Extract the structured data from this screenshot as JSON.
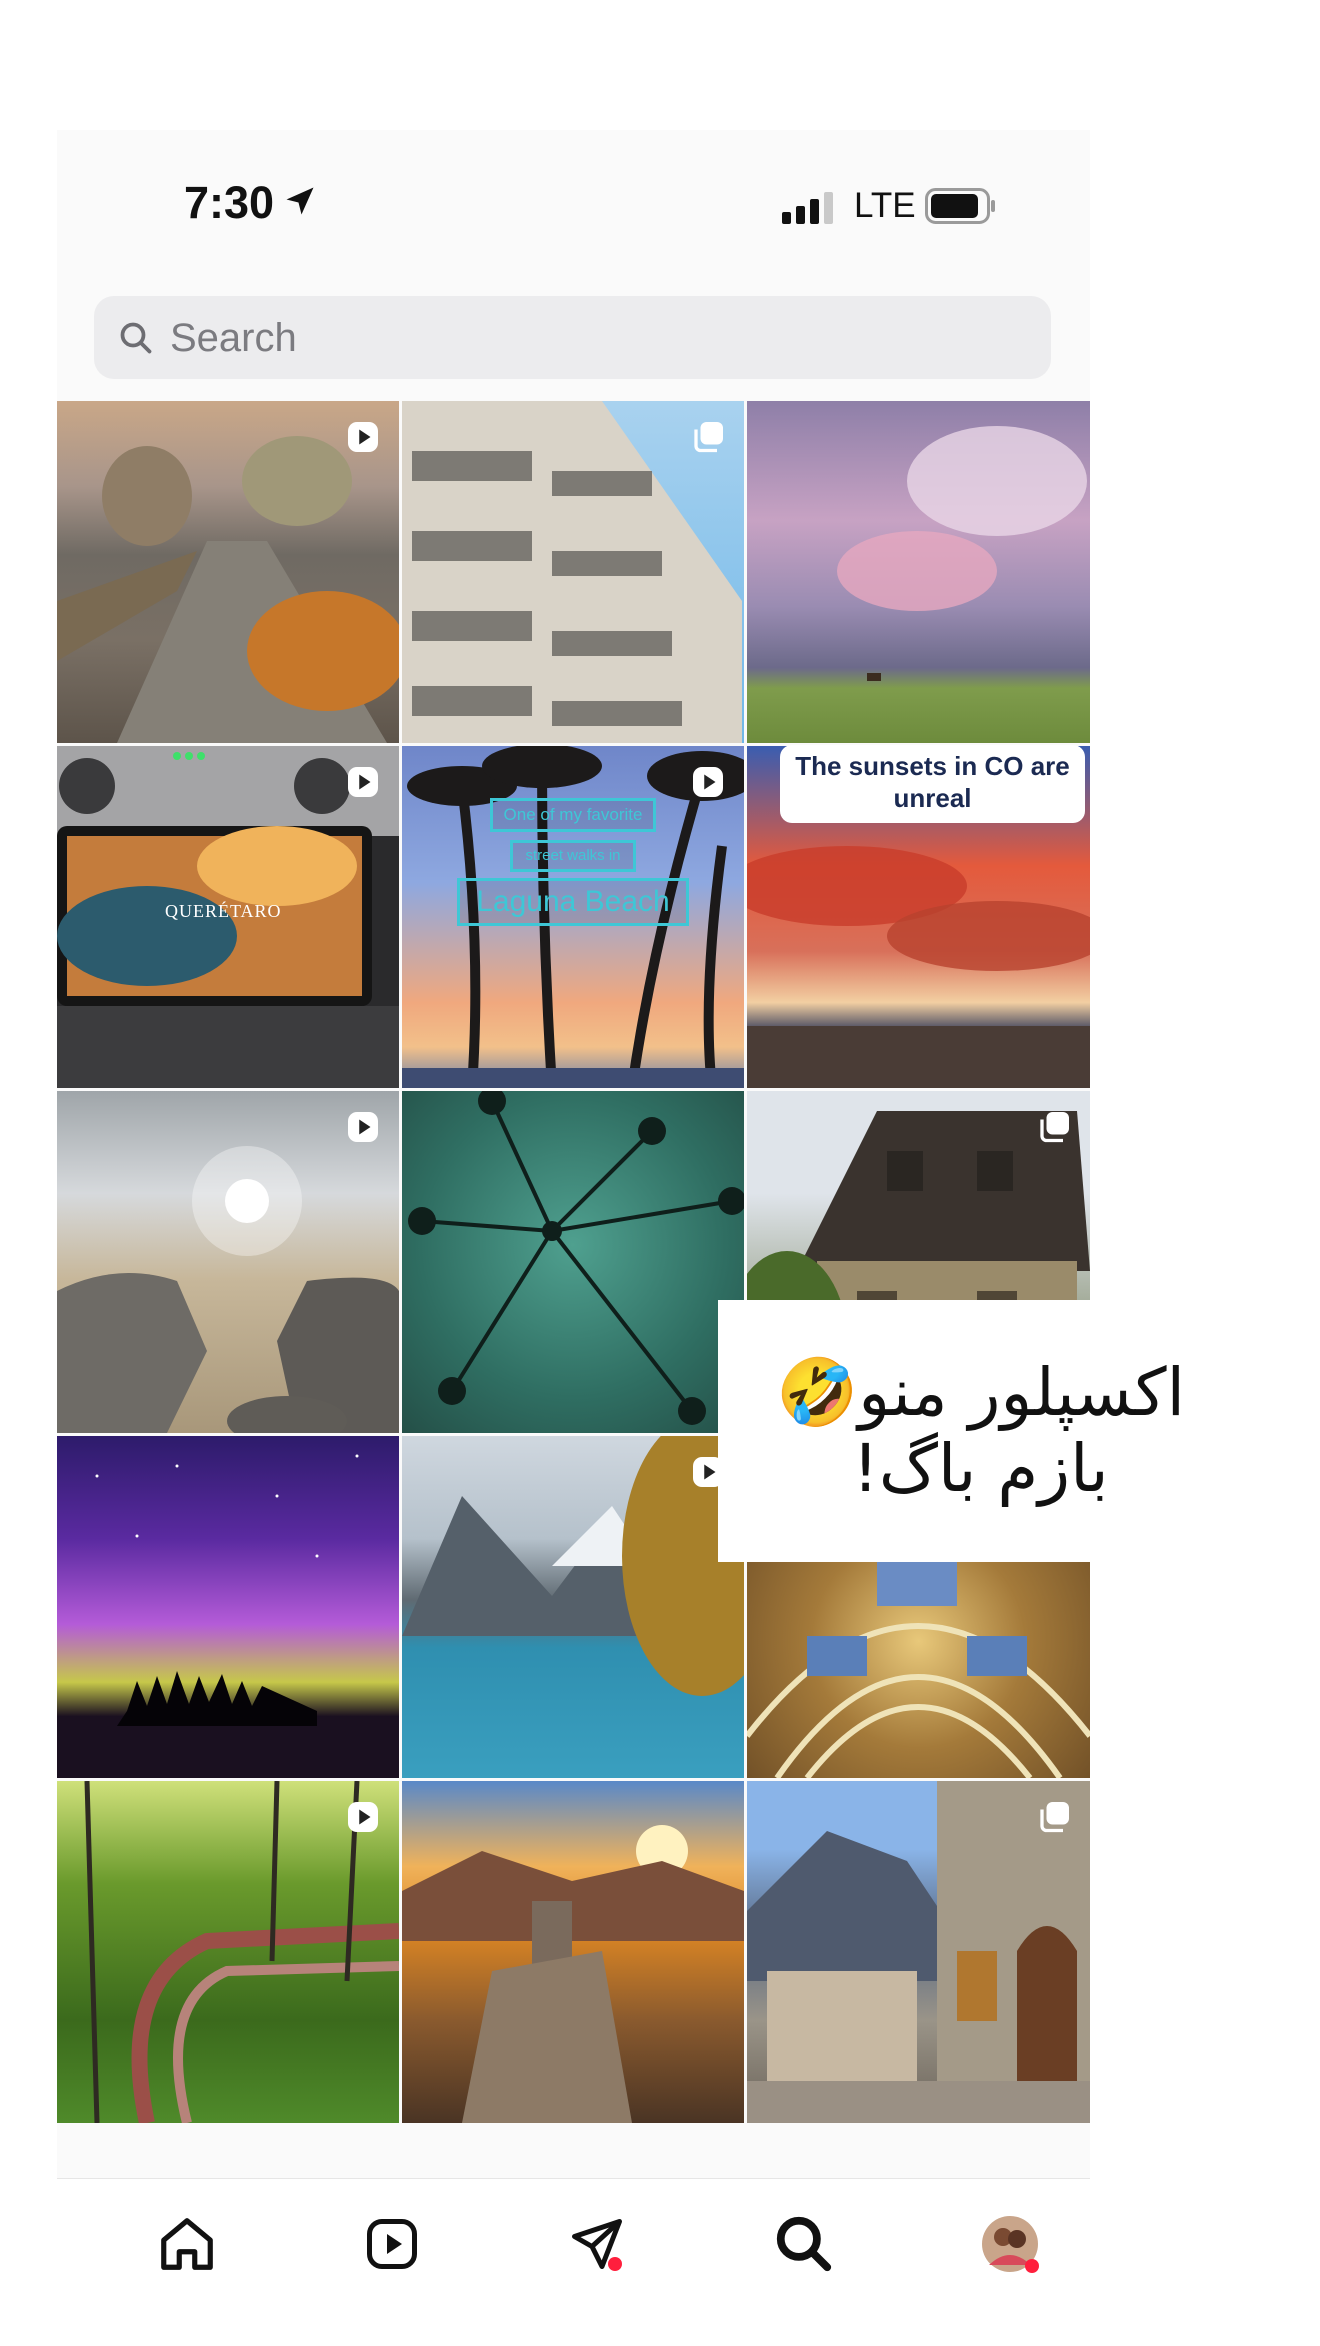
{
  "status_bar": {
    "time": "7:30",
    "network": "LTE"
  },
  "search": {
    "placeholder": "Search"
  },
  "grid": {
    "tiles": [
      {
        "subject": "autumn pier path at sunset",
        "badge": "reel-icon"
      },
      {
        "subject": "apartment balconies against blue sky",
        "badge": "carousel-icon"
      },
      {
        "subject": "pink storm clouds over prairie with bison",
        "badge": "none"
      },
      {
        "subject": "drone controller screen",
        "badge": "reel-icon",
        "text": "QUERÉTARO"
      },
      {
        "subject": "palm trees at sunset",
        "badge": "reel-icon",
        "texts": [
          "One of my favorite",
          "street walks in",
          "Laguna Beach"
        ]
      },
      {
        "subject": "red sunset clouds over town",
        "badge": "reel-icon",
        "text": "The sunsets in CO are unreal"
      },
      {
        "subject": "sunlight through clear water over rocks",
        "badge": "reel-icon"
      },
      {
        "subject": "rain drops on glass with palm trees",
        "badge": "none"
      },
      {
        "subject": "thatched cottage",
        "badge": "carousel-icon"
      },
      {
        "subject": "northern lights over island",
        "badge": "none"
      },
      {
        "subject": "mountain lake with autumn leaves",
        "badge": "reel-icon"
      },
      {
        "subject": "painted palace ceiling",
        "badge": "none"
      },
      {
        "subject": "wooden walkway in green forest",
        "badge": "reel-icon"
      },
      {
        "subject": "castle ruin in autumn valley at sunrise",
        "badge": "none"
      },
      {
        "subject": "stone village street",
        "badge": "carousel-icon"
      }
    ]
  },
  "overlay_text": {
    "line1": "اکسپلور منو🤣",
    "line2": "بازم باگ!"
  },
  "nav": {
    "items": [
      {
        "name": "home-icon"
      },
      {
        "name": "reels-icon"
      },
      {
        "name": "direct-messages-icon",
        "has_notification": true
      },
      {
        "name": "search-icon",
        "active": true
      },
      {
        "name": "profile-avatar",
        "has_notification": true
      }
    ]
  },
  "colors": {
    "notification": "#ff1f3d",
    "search_bg": "#ececee"
  }
}
